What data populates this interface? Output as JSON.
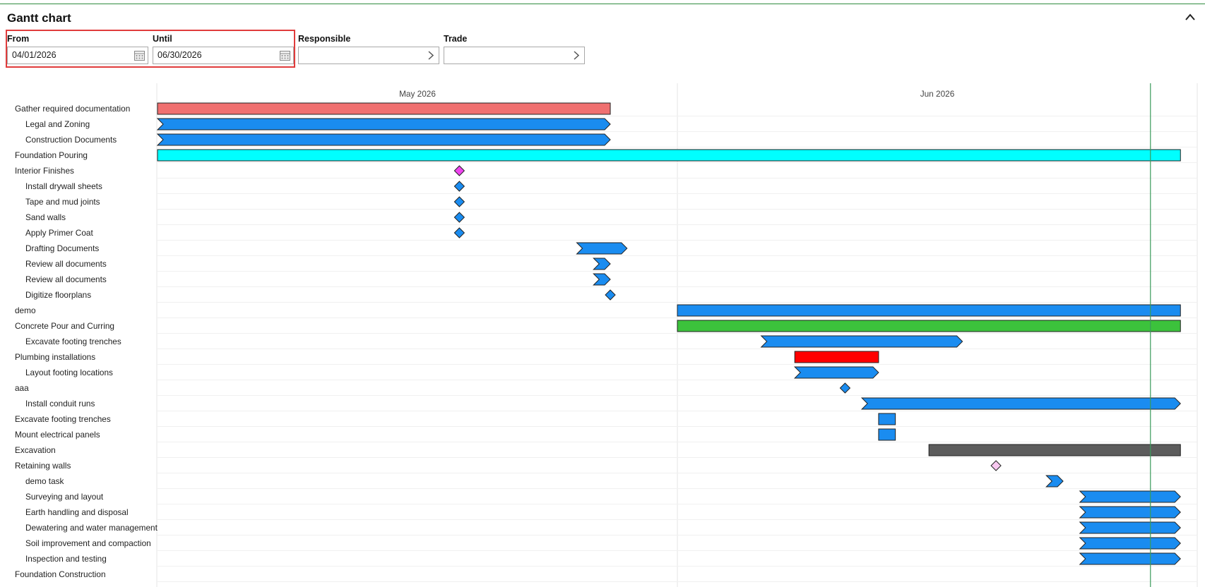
{
  "panel": {
    "title": "Gantt chart"
  },
  "filters": {
    "from_label": "From",
    "from_value": "04/01/2026",
    "until_label": "Until",
    "until_value": "06/30/2026",
    "responsible_label": "Responsible",
    "responsible_value": "",
    "trade_label": "Trade",
    "trade_value": ""
  },
  "icons": {
    "collapse": "chevron-up-icon",
    "from_picker": "calendar-icon",
    "until_picker": "calendar-icon",
    "responsible_picker": "chevron-right-icon",
    "trade_picker": "chevron-right-icon"
  },
  "colors": {
    "task": "#1a8cf0",
    "summary_red": "#f07070",
    "foundation": "#00ffff",
    "concrete": "#3cc23c",
    "plumbing": "#ff0000",
    "excavation": "#5c5c5c",
    "milestone_interior": "#ee44ee",
    "milestone_retaining": "#f8c8f0",
    "today_line": "#3a9a5a",
    "filter_highlight": "#e03c3c"
  },
  "chart_data": {
    "type": "gantt",
    "timeline_start": "2026-04-01",
    "timeline_end": "2026-06-30",
    "months": [
      {
        "label": "May 2026",
        "start": "2026-05-01"
      },
      {
        "label": "Jun 2026",
        "start": "2026-06-01"
      }
    ],
    "today": "2026-06-29",
    "rows": [
      {
        "name": "Gather required documentation",
        "indent": 0,
        "kind": "bar",
        "start": "2026-05-01",
        "end": "2026-05-28",
        "color": "#f07070",
        "clipped_left": false
      },
      {
        "name": "Legal and Zoning",
        "indent": 1,
        "kind": "arrow",
        "start": "2026-05-01",
        "end": "2026-05-28",
        "color": "#1a8cf0",
        "clipped_left": true
      },
      {
        "name": "Construction Documents",
        "indent": 1,
        "kind": "arrow",
        "start": "2026-05-01",
        "end": "2026-05-28",
        "color": "#1a8cf0",
        "clipped_left": true
      },
      {
        "name": "Foundation Pouring",
        "indent": 0,
        "kind": "bar",
        "start": "2026-05-01",
        "end": "2026-07-01",
        "color": "#00ffff",
        "clipped_left": false
      },
      {
        "name": "Interior Finishes",
        "indent": 0,
        "kind": "milestone",
        "start": "2026-05-19",
        "color": "#ee44ee"
      },
      {
        "name": "Install drywall sheets",
        "indent": 1,
        "kind": "milestone",
        "start": "2026-05-19",
        "color": "#1a8cf0"
      },
      {
        "name": "Tape and mud joints",
        "indent": 1,
        "kind": "milestone",
        "start": "2026-05-19",
        "color": "#1a8cf0"
      },
      {
        "name": "Sand walls",
        "indent": 1,
        "kind": "milestone",
        "start": "2026-05-19",
        "color": "#1a8cf0"
      },
      {
        "name": "Apply Primer Coat",
        "indent": 1,
        "kind": "milestone",
        "start": "2026-05-19",
        "color": "#1a8cf0"
      },
      {
        "name": "Drafting Documents",
        "indent": 1,
        "kind": "arrow",
        "start": "2026-05-26",
        "end": "2026-05-29",
        "color": "#1a8cf0",
        "clipped_left": false
      },
      {
        "name": "Review all documents",
        "indent": 1,
        "kind": "arrow",
        "start": "2026-05-27",
        "end": "2026-05-28",
        "color": "#1a8cf0",
        "clipped_left": false
      },
      {
        "name": "Review all documents",
        "indent": 1,
        "kind": "arrow",
        "start": "2026-05-27",
        "end": "2026-05-28",
        "color": "#1a8cf0",
        "clipped_left": false
      },
      {
        "name": "Digitize floorplans",
        "indent": 1,
        "kind": "milestone",
        "start": "2026-05-28",
        "color": "#1a8cf0"
      },
      {
        "name": "demo",
        "indent": 0,
        "kind": "bar",
        "start": "2026-06-01",
        "end": "2026-07-01",
        "color": "#1a8cf0",
        "clipped_left": false
      },
      {
        "name": "Concrete Pour and Curring",
        "indent": 0,
        "kind": "bar",
        "start": "2026-06-01",
        "end": "2026-07-01",
        "color": "#3cc23c",
        "clipped_left": false
      },
      {
        "name": "Excavate footing trenches",
        "indent": 1,
        "kind": "arrow",
        "start": "2026-06-06",
        "end": "2026-06-18",
        "color": "#1a8cf0",
        "clipped_left": false
      },
      {
        "name": "Plumbing installations",
        "indent": 0,
        "kind": "bar",
        "start": "2026-06-08",
        "end": "2026-06-13",
        "color": "#ff0000",
        "clipped_left": false
      },
      {
        "name": "Layout footing locations",
        "indent": 1,
        "kind": "arrow",
        "start": "2026-06-08",
        "end": "2026-06-13",
        "color": "#1a8cf0",
        "clipped_left": false
      },
      {
        "name": "aaa",
        "indent": 0,
        "kind": "milestone",
        "start": "2026-06-11",
        "color": "#1a8cf0"
      },
      {
        "name": "Install conduit runs",
        "indent": 1,
        "kind": "arrow",
        "start": "2026-06-12",
        "end": "2026-07-01",
        "color": "#1a8cf0",
        "clipped_left": false
      },
      {
        "name": "Excavate footing trenches",
        "indent": 0,
        "kind": "bar",
        "start": "2026-06-13",
        "end": "2026-06-14",
        "color": "#1a8cf0",
        "clipped_left": false
      },
      {
        "name": "Mount electrical panels",
        "indent": 0,
        "kind": "bar",
        "start": "2026-06-13",
        "end": "2026-06-14",
        "color": "#1a8cf0",
        "clipped_left": false
      },
      {
        "name": "Excavation",
        "indent": 0,
        "kind": "bar",
        "start": "2026-06-16",
        "end": "2026-07-01",
        "color": "#5c5c5c",
        "clipped_left": false
      },
      {
        "name": "Retaining walls",
        "indent": 0,
        "kind": "milestone",
        "start": "2026-06-20",
        "color": "#f8c8f0"
      },
      {
        "name": "demo task",
        "indent": 1,
        "kind": "arrow",
        "start": "2026-06-23",
        "end": "2026-06-24",
        "color": "#1a8cf0",
        "clipped_left": false
      },
      {
        "name": "Surveying and layout",
        "indent": 1,
        "kind": "arrow",
        "start": "2026-06-25",
        "end": "2026-07-01",
        "color": "#1a8cf0",
        "clipped_left": false
      },
      {
        "name": "Earth handling and disposal",
        "indent": 1,
        "kind": "arrow",
        "start": "2026-06-25",
        "end": "2026-07-01",
        "color": "#1a8cf0",
        "clipped_left": false
      },
      {
        "name": "Dewatering and water management",
        "indent": 1,
        "kind": "arrow",
        "start": "2026-06-25",
        "end": "2026-07-01",
        "color": "#1a8cf0",
        "clipped_left": false
      },
      {
        "name": "Soil improvement and compaction",
        "indent": 1,
        "kind": "arrow",
        "start": "2026-06-25",
        "end": "2026-07-01",
        "color": "#1a8cf0",
        "clipped_left": false
      },
      {
        "name": "Inspection and testing",
        "indent": 1,
        "kind": "arrow",
        "start": "2026-06-25",
        "end": "2026-07-01",
        "color": "#1a8cf0",
        "clipped_left": false
      },
      {
        "name": "Foundation Construction",
        "indent": 0,
        "kind": "none"
      }
    ]
  }
}
